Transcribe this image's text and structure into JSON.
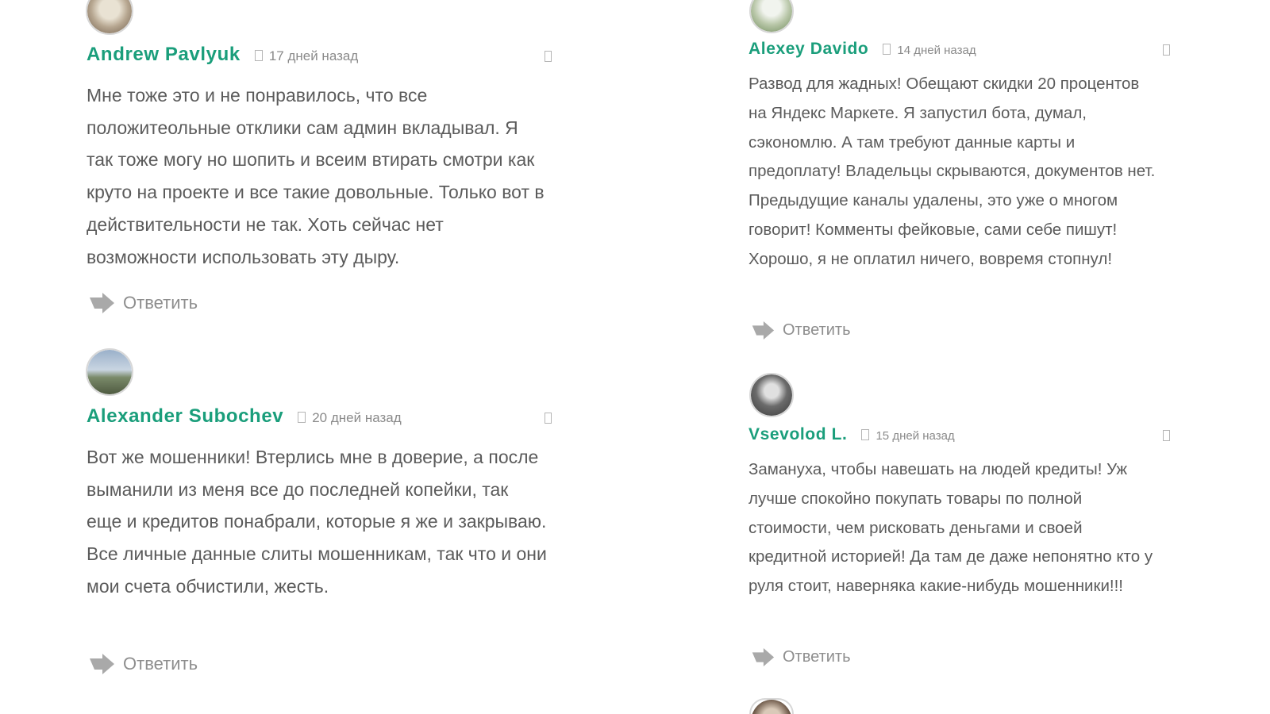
{
  "comments_left": [
    {
      "author": "Andrew Pavlyuk",
      "date": "17 дней назад",
      "text": "Мне тоже это и не понравилось, что все положитеольные отклики сам админ вкладывал. Я так тоже могу но шопить и всеим втирать смотри как круто на проекте и все такие довольные. Только вот в действительности не так. Хоть сейчас нет возможности использовать эту дыру.",
      "reply_label": "Ответить"
    },
    {
      "author": "Alexander Subochev",
      "date": "20 дней назад",
      "text": "Вот же мошенники! Втерлись мне в доверие, а после выманили из меня все до последней копейки, так еще и кредитов понабрали, которые я же и закрываю. Все личные данные слиты мошенникам, так что и они мои счета обчистили, жесть.",
      "reply_label": "Ответить"
    }
  ],
  "comments_right": [
    {
      "author": "Alexey Davido",
      "date": "14 дней назад",
      "text": "Развод для жадных! Обещают скидки 20 процентов на Яндекс Маркете. Я запустил бота, думал, сэкономлю. А там требуют данные карты и предоплату! Владельцы скрываются, документов нет. Предыдущие каналы удалены, это уже о многом говорит! Комменты фейковые, сами себе пишут! Хорошо, я не оплатил ничего, вовремя стопнул!",
      "reply_label": "Ответить"
    },
    {
      "author": "Vsevolod L.",
      "date": "15 дней назад",
      "text": "Замануха, чтобы навешать на людей кредиты! Уж лучше спокойно покупать товары по полной стоимости, чем рисковать деньгами и своей кредитной историей! Да там де даже непонятно кто у руля стоит, наверняка какие-нибудь мошенники!!!",
      "reply_label": "Ответить"
    }
  ],
  "colors": {
    "author": "#1a9e7b",
    "text": "#5b5b5b",
    "meta": "#8a8a8a",
    "reply_icon": "#a9a9a9"
  },
  "icons": {
    "date": "clock-icon",
    "flag": "flag-icon",
    "reply": "reply-arrow-icon"
  }
}
